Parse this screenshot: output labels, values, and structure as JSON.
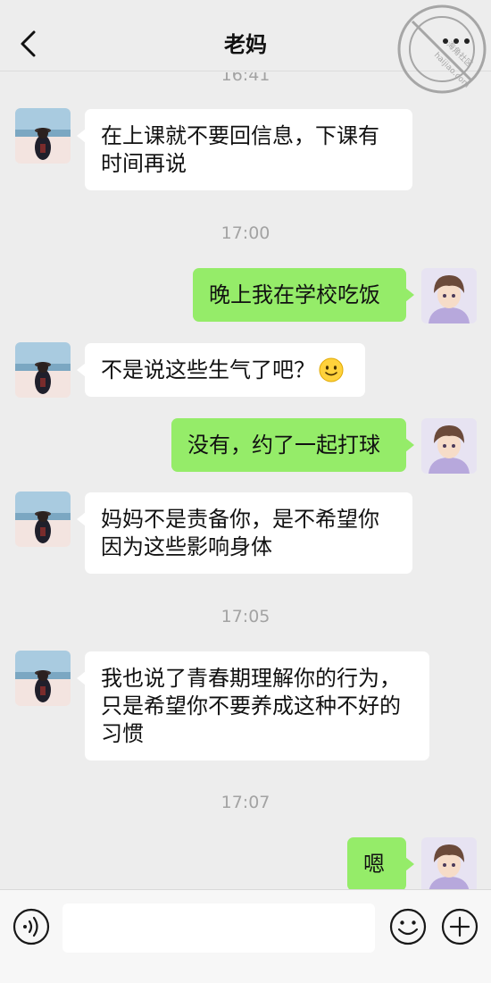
{
  "header": {
    "title": "老妈",
    "back_icon": "chevron-left-icon",
    "more_icon": "more-dots-icon",
    "watermark_text": "haijiao.com",
    "watermark_text_cn": "海角社区"
  },
  "messages": {
    "top_time": "16:41",
    "m1": "在上课就不要回信息，下课有时间再说",
    "t2": "17:00",
    "m2": "晚上我在学校吃饭",
    "m3": "不是说这些生气了吧？",
    "m3_emoji": "smile-emoji",
    "m4": "没有，约了一起打球",
    "m5": "妈妈不是责备你，是不希望你因为这些影响身体",
    "t3": "17:05",
    "m6": "我也说了青春期理解你的行为，只是希望你不要养成这种不好的习惯",
    "t4": "17:07",
    "m7": "嗯"
  },
  "input_bar": {
    "voice_icon": "voice-icon",
    "text_value": "",
    "emoji_icon": "emoji-icon",
    "plus_icon": "plus-icon"
  },
  "colors": {
    "background": "#ededed",
    "outgoing_bubble": "#95ec69",
    "incoming_bubble": "#ffffff",
    "time_text": "#a3a3a3"
  }
}
